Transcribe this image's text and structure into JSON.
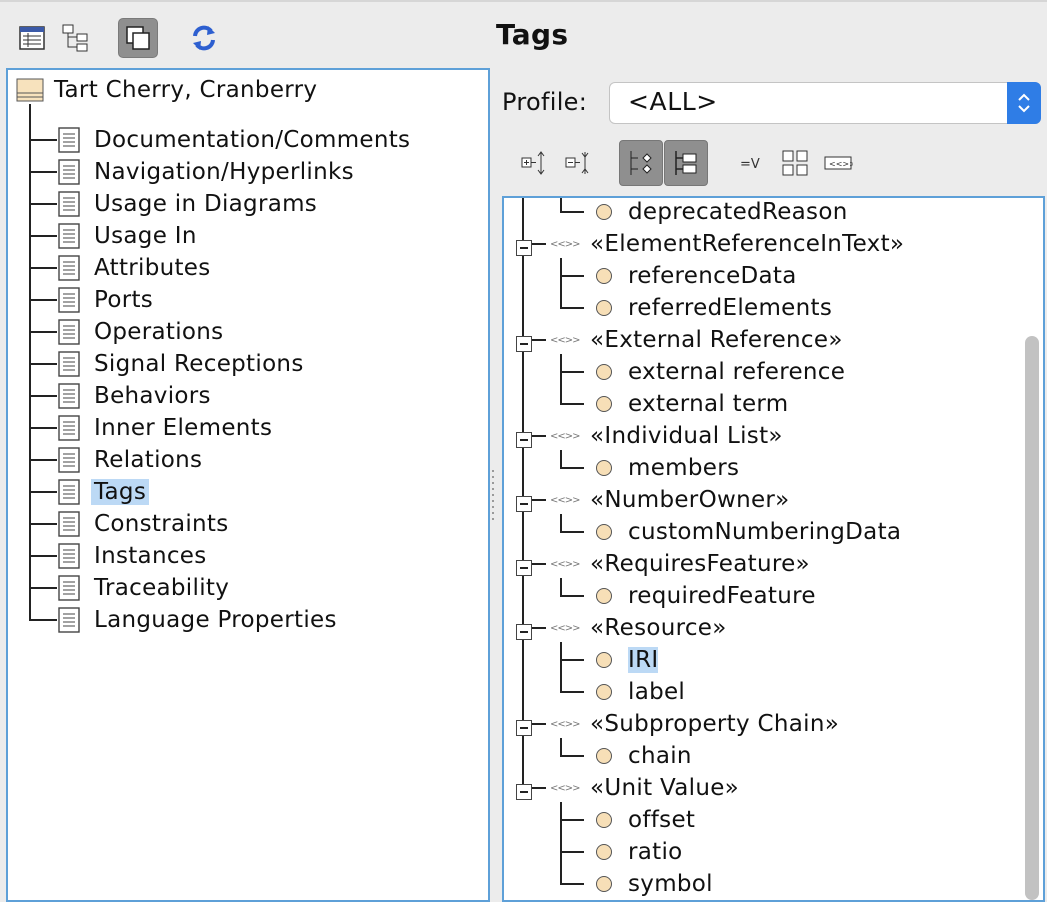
{
  "left_panel": {
    "root": {
      "label": "Tart Cherry, Cranberry",
      "icon": "package-icon"
    },
    "items": [
      {
        "label": "Documentation/Comments",
        "selected": false
      },
      {
        "label": "Navigation/Hyperlinks",
        "selected": false
      },
      {
        "label": "Usage in Diagrams",
        "selected": false
      },
      {
        "label": "Usage In",
        "selected": false
      },
      {
        "label": "Attributes",
        "selected": false
      },
      {
        "label": "Ports",
        "selected": false
      },
      {
        "label": "Operations",
        "selected": false
      },
      {
        "label": "Signal Receptions",
        "selected": false
      },
      {
        "label": "Behaviors",
        "selected": false
      },
      {
        "label": "Inner Elements",
        "selected": false
      },
      {
        "label": "Relations",
        "selected": false
      },
      {
        "label": "Tags",
        "selected": true
      },
      {
        "label": "Constraints",
        "selected": false
      },
      {
        "label": "Instances",
        "selected": false
      },
      {
        "label": "Traceability",
        "selected": false
      },
      {
        "label": "Language Properties",
        "selected": false
      }
    ],
    "toolbar": [
      "table-view-icon",
      "tree-view-icon",
      "copy-icon",
      "refresh-icon"
    ]
  },
  "right_panel": {
    "title": "Tags",
    "profile": {
      "label": "Profile:",
      "value": "<ALL>"
    },
    "toolbar": [
      "expand-all-icon",
      "collapse-all-icon",
      "group-by-icon",
      "tree-mode-icon",
      "show-values-icon",
      "grid-icon",
      "stereotype-icon"
    ],
    "tree": {
      "partial_top_tag": "deprecatedReason",
      "stereotypes": [
        {
          "name": "«ElementReferenceInText»",
          "tags": [
            "referenceData",
            "referredElements"
          ]
        },
        {
          "name": "«External Reference»",
          "tags": [
            "external reference",
            "external term"
          ]
        },
        {
          "name": "«Individual List»",
          "tags": [
            "members"
          ]
        },
        {
          "name": "«NumberOwner»",
          "tags": [
            "customNumberingData"
          ]
        },
        {
          "name": "«RequiresFeature»",
          "tags": [
            "requiredFeature"
          ]
        },
        {
          "name": "«Resource»",
          "tags": [
            "IRI",
            "label"
          ]
        },
        {
          "name": "«Subproperty Chain»",
          "tags": [
            "chain"
          ]
        },
        {
          "name": "«Unit Value»",
          "tags": [
            "offset",
            "ratio",
            "symbol"
          ]
        }
      ],
      "selected_tag": "IRI"
    }
  },
  "colors": {
    "accent": "#5ea0d8",
    "selection": "#bcd9f5",
    "select_arrow": "#2f7de6"
  }
}
